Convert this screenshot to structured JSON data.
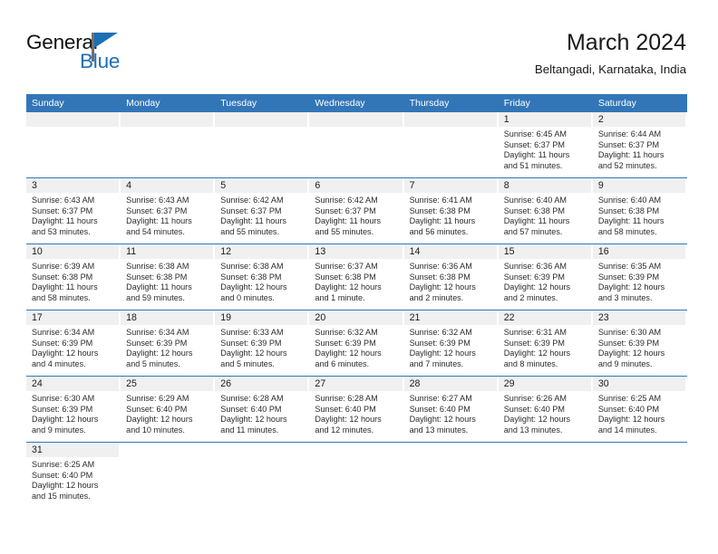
{
  "brand": {
    "name_part1": "General",
    "name_part2": "Blue",
    "accent_color": "#1c6fb5"
  },
  "header": {
    "month_title": "March 2024",
    "location": "Beltangadi, Karnataka, India"
  },
  "calendar": {
    "header_color": "#3276b8",
    "day_band_color": "#f0f0f0",
    "weekday_names": [
      "Sunday",
      "Monday",
      "Tuesday",
      "Wednesday",
      "Thursday",
      "Friday",
      "Saturday"
    ],
    "weeks": [
      [
        {
          "day": "",
          "empty": true,
          "sunrise": "",
          "sunset": "",
          "daylight1": "",
          "daylight2": ""
        },
        {
          "day": "",
          "empty": true,
          "sunrise": "",
          "sunset": "",
          "daylight1": "",
          "daylight2": ""
        },
        {
          "day": "",
          "empty": true,
          "sunrise": "",
          "sunset": "",
          "daylight1": "",
          "daylight2": ""
        },
        {
          "day": "",
          "empty": true,
          "sunrise": "",
          "sunset": "",
          "daylight1": "",
          "daylight2": ""
        },
        {
          "day": "",
          "empty": true,
          "sunrise": "",
          "sunset": "",
          "daylight1": "",
          "daylight2": ""
        },
        {
          "day": "1",
          "sunrise": "Sunrise: 6:45 AM",
          "sunset": "Sunset: 6:37 PM",
          "daylight1": "Daylight: 11 hours",
          "daylight2": "and 51 minutes."
        },
        {
          "day": "2",
          "sunrise": "Sunrise: 6:44 AM",
          "sunset": "Sunset: 6:37 PM",
          "daylight1": "Daylight: 11 hours",
          "daylight2": "and 52 minutes."
        }
      ],
      [
        {
          "day": "3",
          "sunrise": "Sunrise: 6:43 AM",
          "sunset": "Sunset: 6:37 PM",
          "daylight1": "Daylight: 11 hours",
          "daylight2": "and 53 minutes."
        },
        {
          "day": "4",
          "sunrise": "Sunrise: 6:43 AM",
          "sunset": "Sunset: 6:37 PM",
          "daylight1": "Daylight: 11 hours",
          "daylight2": "and 54 minutes."
        },
        {
          "day": "5",
          "sunrise": "Sunrise: 6:42 AM",
          "sunset": "Sunset: 6:37 PM",
          "daylight1": "Daylight: 11 hours",
          "daylight2": "and 55 minutes."
        },
        {
          "day": "6",
          "sunrise": "Sunrise: 6:42 AM",
          "sunset": "Sunset: 6:37 PM",
          "daylight1": "Daylight: 11 hours",
          "daylight2": "and 55 minutes."
        },
        {
          "day": "7",
          "sunrise": "Sunrise: 6:41 AM",
          "sunset": "Sunset: 6:38 PM",
          "daylight1": "Daylight: 11 hours",
          "daylight2": "and 56 minutes."
        },
        {
          "day": "8",
          "sunrise": "Sunrise: 6:40 AM",
          "sunset": "Sunset: 6:38 PM",
          "daylight1": "Daylight: 11 hours",
          "daylight2": "and 57 minutes."
        },
        {
          "day": "9",
          "sunrise": "Sunrise: 6:40 AM",
          "sunset": "Sunset: 6:38 PM",
          "daylight1": "Daylight: 11 hours",
          "daylight2": "and 58 minutes."
        }
      ],
      [
        {
          "day": "10",
          "sunrise": "Sunrise: 6:39 AM",
          "sunset": "Sunset: 6:38 PM",
          "daylight1": "Daylight: 11 hours",
          "daylight2": "and 58 minutes."
        },
        {
          "day": "11",
          "sunrise": "Sunrise: 6:38 AM",
          "sunset": "Sunset: 6:38 PM",
          "daylight1": "Daylight: 11 hours",
          "daylight2": "and 59 minutes."
        },
        {
          "day": "12",
          "sunrise": "Sunrise: 6:38 AM",
          "sunset": "Sunset: 6:38 PM",
          "daylight1": "Daylight: 12 hours",
          "daylight2": "and 0 minutes."
        },
        {
          "day": "13",
          "sunrise": "Sunrise: 6:37 AM",
          "sunset": "Sunset: 6:38 PM",
          "daylight1": "Daylight: 12 hours",
          "daylight2": "and 1 minute."
        },
        {
          "day": "14",
          "sunrise": "Sunrise: 6:36 AM",
          "sunset": "Sunset: 6:38 PM",
          "daylight1": "Daylight: 12 hours",
          "daylight2": "and 2 minutes."
        },
        {
          "day": "15",
          "sunrise": "Sunrise: 6:36 AM",
          "sunset": "Sunset: 6:39 PM",
          "daylight1": "Daylight: 12 hours",
          "daylight2": "and 2 minutes."
        },
        {
          "day": "16",
          "sunrise": "Sunrise: 6:35 AM",
          "sunset": "Sunset: 6:39 PM",
          "daylight1": "Daylight: 12 hours",
          "daylight2": "and 3 minutes."
        }
      ],
      [
        {
          "day": "17",
          "sunrise": "Sunrise: 6:34 AM",
          "sunset": "Sunset: 6:39 PM",
          "daylight1": "Daylight: 12 hours",
          "daylight2": "and 4 minutes."
        },
        {
          "day": "18",
          "sunrise": "Sunrise: 6:34 AM",
          "sunset": "Sunset: 6:39 PM",
          "daylight1": "Daylight: 12 hours",
          "daylight2": "and 5 minutes."
        },
        {
          "day": "19",
          "sunrise": "Sunrise: 6:33 AM",
          "sunset": "Sunset: 6:39 PM",
          "daylight1": "Daylight: 12 hours",
          "daylight2": "and 5 minutes."
        },
        {
          "day": "20",
          "sunrise": "Sunrise: 6:32 AM",
          "sunset": "Sunset: 6:39 PM",
          "daylight1": "Daylight: 12 hours",
          "daylight2": "and 6 minutes."
        },
        {
          "day": "21",
          "sunrise": "Sunrise: 6:32 AM",
          "sunset": "Sunset: 6:39 PM",
          "daylight1": "Daylight: 12 hours",
          "daylight2": "and 7 minutes."
        },
        {
          "day": "22",
          "sunrise": "Sunrise: 6:31 AM",
          "sunset": "Sunset: 6:39 PM",
          "daylight1": "Daylight: 12 hours",
          "daylight2": "and 8 minutes."
        },
        {
          "day": "23",
          "sunrise": "Sunrise: 6:30 AM",
          "sunset": "Sunset: 6:39 PM",
          "daylight1": "Daylight: 12 hours",
          "daylight2": "and 9 minutes."
        }
      ],
      [
        {
          "day": "24",
          "sunrise": "Sunrise: 6:30 AM",
          "sunset": "Sunset: 6:39 PM",
          "daylight1": "Daylight: 12 hours",
          "daylight2": "and 9 minutes."
        },
        {
          "day": "25",
          "sunrise": "Sunrise: 6:29 AM",
          "sunset": "Sunset: 6:40 PM",
          "daylight1": "Daylight: 12 hours",
          "daylight2": "and 10 minutes."
        },
        {
          "day": "26",
          "sunrise": "Sunrise: 6:28 AM",
          "sunset": "Sunset: 6:40 PM",
          "daylight1": "Daylight: 12 hours",
          "daylight2": "and 11 minutes."
        },
        {
          "day": "27",
          "sunrise": "Sunrise: 6:28 AM",
          "sunset": "Sunset: 6:40 PM",
          "daylight1": "Daylight: 12 hours",
          "daylight2": "and 12 minutes."
        },
        {
          "day": "28",
          "sunrise": "Sunrise: 6:27 AM",
          "sunset": "Sunset: 6:40 PM",
          "daylight1": "Daylight: 12 hours",
          "daylight2": "and 13 minutes."
        },
        {
          "day": "29",
          "sunrise": "Sunrise: 6:26 AM",
          "sunset": "Sunset: 6:40 PM",
          "daylight1": "Daylight: 12 hours",
          "daylight2": "and 13 minutes."
        },
        {
          "day": "30",
          "sunrise": "Sunrise: 6:25 AM",
          "sunset": "Sunset: 6:40 PM",
          "daylight1": "Daylight: 12 hours",
          "daylight2": "and 14 minutes."
        }
      ],
      [
        {
          "day": "31",
          "sunrise": "Sunrise: 6:25 AM",
          "sunset": "Sunset: 6:40 PM",
          "daylight1": "Daylight: 12 hours",
          "daylight2": "and 15 minutes."
        },
        {
          "day": "",
          "blank_tail": true,
          "sunrise": "",
          "sunset": "",
          "daylight1": "",
          "daylight2": ""
        },
        {
          "day": "",
          "blank_tail": true,
          "sunrise": "",
          "sunset": "",
          "daylight1": "",
          "daylight2": ""
        },
        {
          "day": "",
          "blank_tail": true,
          "sunrise": "",
          "sunset": "",
          "daylight1": "",
          "daylight2": ""
        },
        {
          "day": "",
          "blank_tail": true,
          "sunrise": "",
          "sunset": "",
          "daylight1": "",
          "daylight2": ""
        },
        {
          "day": "",
          "blank_tail": true,
          "sunrise": "",
          "sunset": "",
          "daylight1": "",
          "daylight2": ""
        },
        {
          "day": "",
          "blank_tail": true,
          "sunrise": "",
          "sunset": "",
          "daylight1": "",
          "daylight2": ""
        }
      ]
    ]
  }
}
